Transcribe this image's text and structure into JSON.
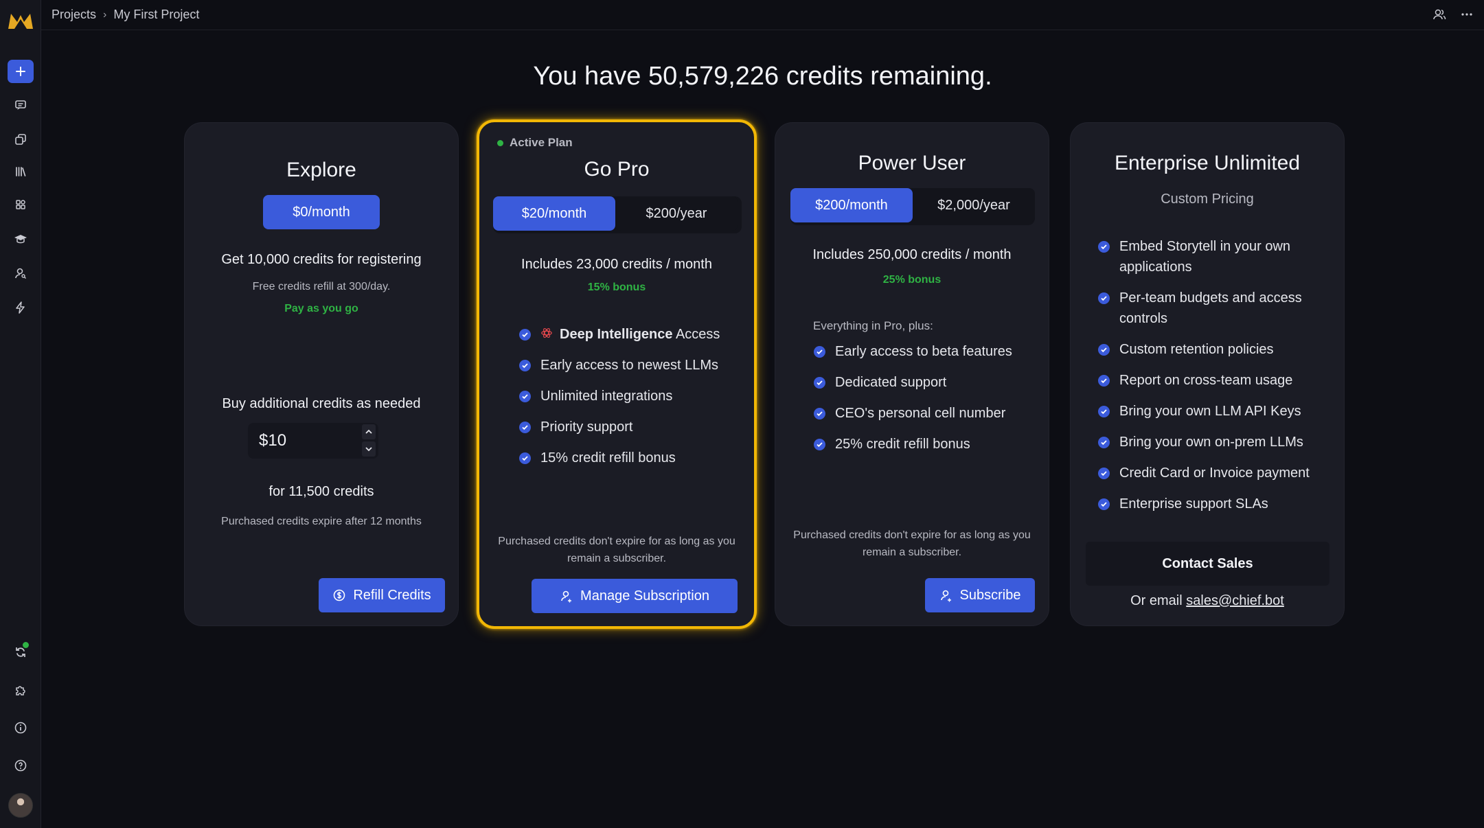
{
  "breadcrumb": {
    "root": "Projects",
    "current": "My First Project"
  },
  "headline": "You have 50,579,226 credits remaining.",
  "plans": {
    "explore": {
      "title": "Explore",
      "price": "$0/month",
      "credits_line": "Get 10,000 credits for registering",
      "refill_line": "Free credits refill at 300/day.",
      "tag": "Pay as you go",
      "buy_heading": "Buy additional credits as needed",
      "amount": "$10",
      "for_credits": "for 11,500 credits",
      "expire_note": "Purchased credits expire after 12 months",
      "button": "Refill Credits"
    },
    "pro": {
      "active_label": "Active Plan",
      "title": "Go Pro",
      "price_monthly": "$20/month",
      "price_yearly": "$200/year",
      "includes": "Includes 23,000 credits / month",
      "bonus": "15% bonus",
      "features": [
        {
          "strong": "Deep Intelligence",
          "text": " Access"
        },
        {
          "strong": "",
          "text": "Early access to newest LLMs"
        },
        {
          "strong": "",
          "text": "Unlimited integrations"
        },
        {
          "strong": "",
          "text": "Priority support"
        },
        {
          "strong": "",
          "text": "15% credit refill bonus"
        }
      ],
      "note": "Purchased credits don't expire for as long as you remain a subscriber.",
      "button": "Manage Subscription"
    },
    "power": {
      "title": "Power User",
      "price_monthly": "$200/month",
      "price_yearly": "$2,000/year",
      "includes": "Includes 250,000 credits / month",
      "bonus": "25% bonus",
      "plus_heading": "Everything in Pro, plus:",
      "features": [
        "Early access to beta features",
        "Dedicated support",
        "CEO's personal cell number",
        "25% credit refill bonus"
      ],
      "note": "Purchased credits don't expire for as long as you remain a subscriber.",
      "button": "Subscribe"
    },
    "enterprise": {
      "title": "Enterprise Unlimited",
      "subtitle": "Custom Pricing",
      "features": [
        "Embed Storytell in your own applications",
        "Per-team budgets and access controls",
        "Custom retention policies",
        "Report on cross-team usage",
        "Bring your own LLM API Keys",
        "Bring your own on-prem LLMs",
        "Credit Card or Invoice payment",
        "Enterprise support SLAs"
      ],
      "button": "Contact Sales",
      "email_prefix": "Or email ",
      "email": "sales@chief.bot"
    }
  },
  "icons": {
    "sidebar": [
      "new-icon",
      "chat-icon",
      "copy-icon",
      "library-icon",
      "apps-icon",
      "graduation-cap-icon",
      "person-search-icon",
      "bolt-icon",
      "sync-icon",
      "puzzle-icon",
      "info-icon",
      "help-icon"
    ],
    "topbar": [
      "users-icon",
      "more-icon"
    ]
  },
  "colors": {
    "accent": "#3b5bdb",
    "active_border": "#f2b705",
    "bonus_green": "#2fb344",
    "background": "#0d0e14",
    "card": "#1b1c25"
  }
}
